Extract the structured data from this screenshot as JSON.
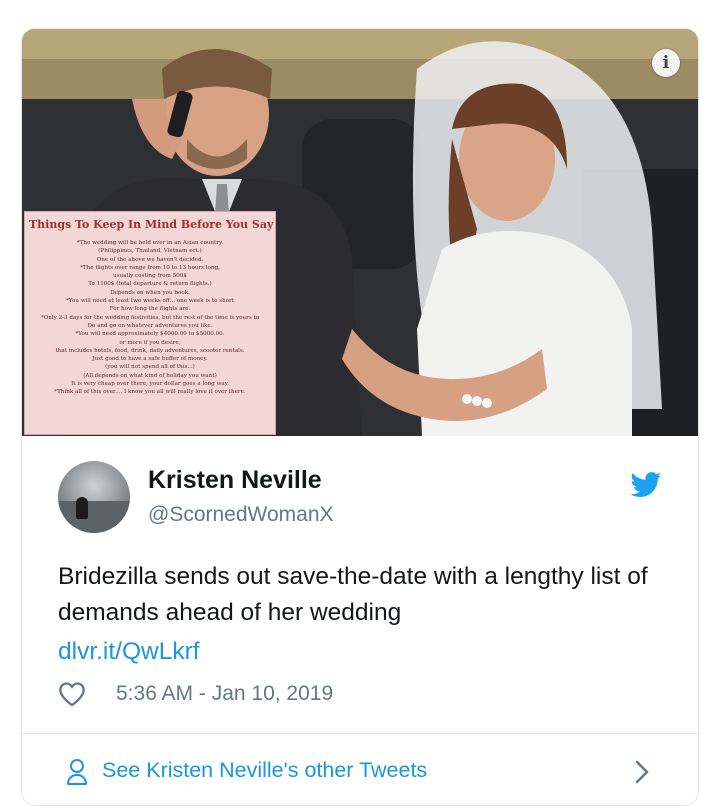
{
  "media": {
    "info_badge": "i",
    "note": {
      "title": "Things To Keep In Mind Before You Say Yes",
      "lines": [
        "*The wedding will be held over in an Asian country.",
        "(Philippines, Thailand, Vietnam ect.)",
        "One of the above we haven't decided.",
        "*The flights over range from 10 to 13 hours long,",
        "usually costing from 500$",
        "To 1100$ (total departure & return flights.)",
        "Depends on when you book.",
        "*You will need at least two weeks off... one week is to short",
        "For how long the flights are.",
        "*Only 2-3 days for the wedding festivities, but the rest of the time is yours to",
        "Do and go on whatever adventures you like.",
        "*You will need approximately $4000.00 to $5000.00.",
        "or more if you desire,",
        "that includes hotels, food, drink, daily adventures, scooter rentals.",
        "Just good to have a safe buffer of money.",
        "(you will not spend all of this...)",
        "(All depends on what kind of holiday you want)",
        "It is very cheap over there, your dollar goes a long way.",
        "*Think all of this over.... I know you all will really love it over there."
      ]
    }
  },
  "author": {
    "name": "Kristen Neville",
    "handle": "@ScornedWomanX"
  },
  "tweet": {
    "text": "Bridezilla sends out save-the-date with a lengthy list of demands ahead of her wedding",
    "link": "dlvr.it/QwLkrf",
    "timestamp": "5:36 AM - Jan 10, 2019"
  },
  "footer": {
    "label": "See Kristen Neville's other Tweets"
  },
  "colors": {
    "link": "#1b95e0",
    "muted": "#657786",
    "border": "#e1e8ed",
    "twitter_blue": "#1da1f2"
  },
  "icons": [
    "info-icon",
    "twitter-bird-icon",
    "heart-icon",
    "user-icon",
    "chevron-right-icon"
  ]
}
